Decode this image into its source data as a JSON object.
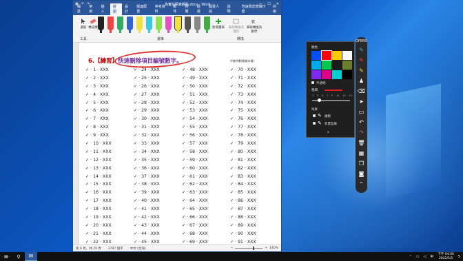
{
  "word": {
    "title": "為實在明意觀點.docx - Word",
    "tabs": [
      "檔案",
      "常用",
      "插入",
      "繪圖",
      "設計",
      "版面配置",
      "參考資料",
      "郵件",
      "校閱",
      "檢視",
      "開發人員",
      "說明"
    ],
    "active_tab": "繪圖",
    "tell_me": "告訴我您想做什麼",
    "share": "共用",
    "ribbon_groups": {
      "tools": "工具",
      "pens": "畫筆",
      "convert": "轉換"
    },
    "ribbon_buttons": {
      "select": "選取",
      "eraser": "橡皮擦",
      "add_pen": "新增畫筆",
      "ink_to_shape": "筆跡轉換為圖形",
      "ink_to_math": "筆跡轉換為數學"
    },
    "heading_num": "6.【練習】",
    "heading_text": "快速刪除項目編號數字",
    "heading_end": "。",
    "mark_title": "中軟件數(數據本質)",
    "list_prefix": "✓ ·",
    "list_suffix": "· XXX",
    "columns": [
      [
        "1",
        "2",
        "3",
        "4",
        "5",
        "6",
        "7",
        "8",
        "9",
        "10",
        "11",
        "12",
        "13",
        "14",
        "15",
        "16",
        "17",
        "18",
        "19",
        "20",
        "21",
        "22"
      ],
      [
        "24",
        "25",
        "26",
        "27",
        "28",
        "29",
        "30",
        "31",
        "32",
        "33",
        "34",
        "35",
        "36",
        "37",
        "38",
        "39",
        "40",
        "41",
        "42",
        "43",
        "44",
        "45"
      ],
      [
        "48",
        "49",
        "50",
        "51",
        "52",
        "53",
        "54",
        "55",
        "56",
        "57",
        "58",
        "59",
        "60",
        "61",
        "62",
        "63",
        "64",
        "65",
        "66",
        "67",
        "68",
        "69"
      ],
      [
        "70",
        "71",
        "72",
        "73",
        "74",
        "75",
        "76",
        "77",
        "78",
        "79",
        "80",
        "81",
        "82",
        "83",
        "84",
        "85",
        "86",
        "87",
        "88",
        "89",
        "90",
        "91"
      ]
    ],
    "status": {
      "page": "第 6 頁，共 29 頁",
      "words": "3787 個字",
      "lang": "中文 (台灣)",
      "zoom": "140%"
    }
  },
  "panel": {
    "color_label": "顏色",
    "transparent_label": "半透明",
    "width_label": "粗細",
    "ticks": [
      "1",
      "3",
      "5",
      "7",
      "9",
      "11",
      "13",
      "15"
    ],
    "effect_label": "效果",
    "opt1": "繪製",
    "opt2": "智慧型筆",
    "colors": [
      "#0050ff",
      "#ff0000",
      "#ffc800",
      "#ffffff",
      "#00aaee",
      "#00c853",
      "#1a1a1a",
      "#6b7d2a",
      "#7b2cf0",
      "#e0008a",
      "#00d0d0",
      "#000000"
    ],
    "selected_color": "#ff0000"
  },
  "pentool": {
    "logo": "OPEN5"
  },
  "taskbar": {
    "time": "下午 04:00",
    "date": "2022/5/5",
    "lang": "中",
    "notif": "5"
  }
}
